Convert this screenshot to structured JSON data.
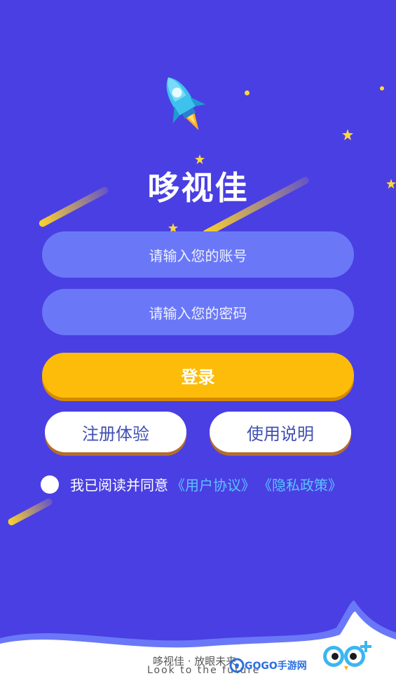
{
  "app": {
    "title": "哆视佳"
  },
  "login_form": {
    "account_placeholder": "请输入您的账号",
    "password_placeholder": "请输入您的密码",
    "login_label": "登录"
  },
  "actions": {
    "register_label": "注册体验",
    "instructions_label": "使用说明"
  },
  "agreement": {
    "prefix": "我已阅读并同意",
    "user_agreement": "《用户协议》",
    "privacy_policy": "《隐私政策》"
  },
  "footer": {
    "slogan_cn": "哆视佳 · 放眼未来",
    "slogan_en": "Look to the future",
    "watermark": "GOGO手游网"
  },
  "colors": {
    "background": "#4a3fe3",
    "input": "#6a78f7",
    "primary": "#fdbc09",
    "link": "#5dc2ff"
  },
  "icons": [
    "rocket-icon",
    "star-icon",
    "meteor-icon",
    "app-logo-icon",
    "radio-icon"
  ]
}
